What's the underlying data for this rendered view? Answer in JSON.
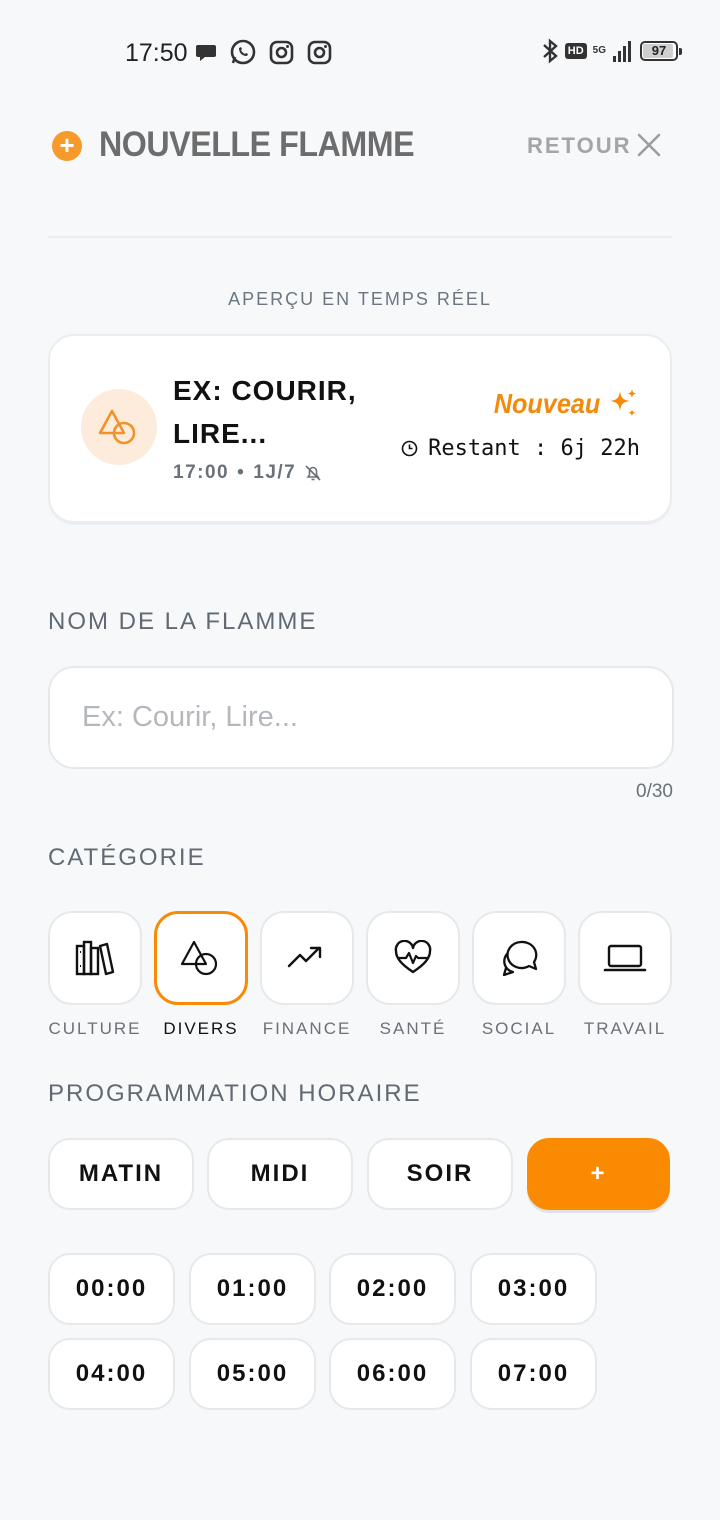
{
  "status_bar": {
    "time": "17:50",
    "network": "5G",
    "hd": "HD",
    "battery": "97"
  },
  "header": {
    "title": "NOUVELLE FLAMME",
    "back_label": "RETOUR"
  },
  "preview": {
    "label": "APERÇU EN TEMPS RÉEL",
    "title": "EX: COURIR, LIRE...",
    "time": "17:00",
    "separator": "•",
    "frequency": "1J/7",
    "badge": "Nouveau",
    "remaining": "Restant : 6j 22h"
  },
  "name_field": {
    "label": "NOM DE LA FLAMME",
    "placeholder": "Ex: Courir, Lire...",
    "value": "",
    "counter": "0/30"
  },
  "categories": {
    "label": "CATÉGORIE",
    "selected": "DIVERS",
    "items": [
      {
        "label": "CULTURE",
        "icon": "books-icon"
      },
      {
        "label": "DIVERS",
        "icon": "shapes-icon"
      },
      {
        "label": "FINANCE",
        "icon": "trending-up-icon"
      },
      {
        "label": "SANTÉ",
        "icon": "heart-pulse-icon"
      },
      {
        "label": "SOCIAL",
        "icon": "chat-bubbles-icon"
      },
      {
        "label": "TRAVAIL",
        "icon": "laptop-icon"
      }
    ]
  },
  "schedule": {
    "label": "PROGRAMMATION HORAIRE",
    "time_of_day": [
      "MATIN",
      "MIDI",
      "SOIR",
      "+"
    ],
    "hours": [
      "00:00",
      "01:00",
      "02:00",
      "03:00",
      "04:00",
      "05:00",
      "06:00",
      "07:00"
    ]
  },
  "colors": {
    "accent": "#fb8a03",
    "background": "#f7f8fa",
    "muted_text": "#6a7179",
    "header_title": "#6d6d6d"
  }
}
